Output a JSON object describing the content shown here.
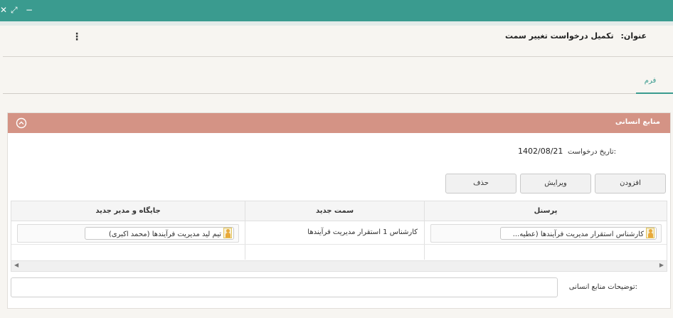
{
  "window": {
    "close_icon": "close-icon",
    "expand_icon": "expand-icon",
    "minimize_icon": "minimize-icon",
    "close_glyph": "✕",
    "expand_glyph": "⤢",
    "minimize_glyph": "−"
  },
  "header": {
    "title_key": "عنوان:",
    "title_value": "تکمیل درخواست تغییر سمت",
    "more_glyph": "⋮"
  },
  "tabs": [
    {
      "label": "فرم",
      "active": true
    }
  ],
  "panel": {
    "title": "منابع انسانی",
    "header_color": "#d49385",
    "request_date_label": "تاریخ درخواست:",
    "request_date_value": "1402/08/21",
    "buttons": {
      "add": "افزودن",
      "edit": "ویرایش",
      "delete": "حذف"
    },
    "grid": {
      "columns": [
        "پرسنل",
        "سمت جدید",
        "جایگاه و مدیر جدید"
      ],
      "rows": [
        {
          "personnel": "کارشناس استقرار مدیریت فرآیندها (عطیه...",
          "new_position": "کارشناس 1 استقرار مدیریت فرآیندها",
          "new_manager": "تیم لید مدیریت فرآیندها (محمد اکبری)"
        }
      ],
      "scroll_left": "◀",
      "scroll_right": "▶"
    },
    "description_label": "توضیحات منابع انسانی:",
    "description_value": ""
  },
  "colors": {
    "titlebar": "#3a9b8f",
    "accent": "#3a9b8f",
    "panel_header": "#d49385"
  }
}
